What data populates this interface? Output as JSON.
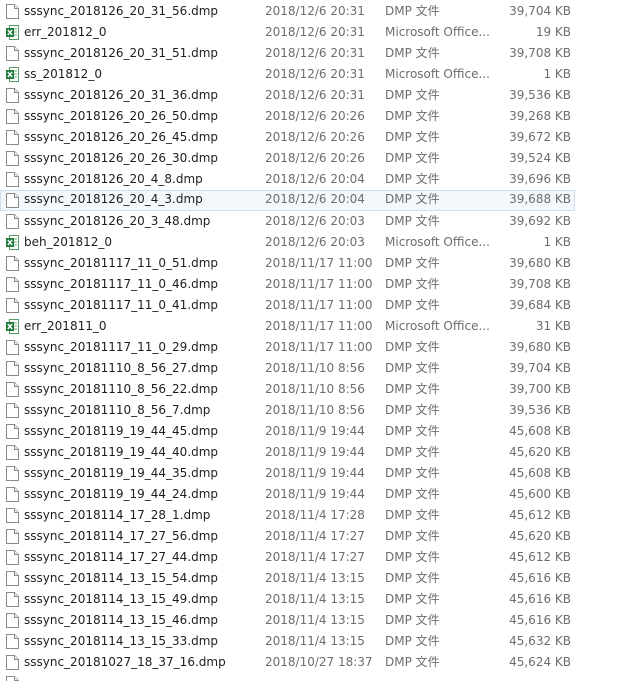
{
  "files": [
    {
      "name": "sssync_2018126_20_31_56.dmp",
      "date": "2018/12/6 20:31",
      "type": "DMP 文件",
      "size": "39,704 KB",
      "icon": "dmp-file-icon"
    },
    {
      "name": "err_201812_0",
      "date": "2018/12/6 20:31",
      "type": "Microsoft Office...",
      "size": "19 KB",
      "icon": "excel-file-icon"
    },
    {
      "name": "sssync_2018126_20_31_51.dmp",
      "date": "2018/12/6 20:31",
      "type": "DMP 文件",
      "size": "39,708 KB",
      "icon": "dmp-file-icon"
    },
    {
      "name": "ss_201812_0",
      "date": "2018/12/6 20:31",
      "type": "Microsoft Office...",
      "size": "1 KB",
      "icon": "excel-file-icon"
    },
    {
      "name": "sssync_2018126_20_31_36.dmp",
      "date": "2018/12/6 20:31",
      "type": "DMP 文件",
      "size": "39,536 KB",
      "icon": "dmp-file-icon"
    },
    {
      "name": "sssync_2018126_20_26_50.dmp",
      "date": "2018/12/6 20:26",
      "type": "DMP 文件",
      "size": "39,268 KB",
      "icon": "dmp-file-icon"
    },
    {
      "name": "sssync_2018126_20_26_45.dmp",
      "date": "2018/12/6 20:26",
      "type": "DMP 文件",
      "size": "39,672 KB",
      "icon": "dmp-file-icon"
    },
    {
      "name": "sssync_2018126_20_26_30.dmp",
      "date": "2018/12/6 20:26",
      "type": "DMP 文件",
      "size": "39,524 KB",
      "icon": "dmp-file-icon"
    },
    {
      "name": "sssync_2018126_20_4_8.dmp",
      "date": "2018/12/6 20:04",
      "type": "DMP 文件",
      "size": "39,696 KB",
      "icon": "dmp-file-icon"
    },
    {
      "name": "sssync_2018126_20_4_3.dmp",
      "date": "2018/12/6 20:04",
      "type": "DMP 文件",
      "size": "39,688 KB",
      "icon": "dmp-file-icon",
      "hovered": true
    },
    {
      "name": "sssync_2018126_20_3_48.dmp",
      "date": "2018/12/6 20:03",
      "type": "DMP 文件",
      "size": "39,692 KB",
      "icon": "dmp-file-icon"
    },
    {
      "name": "beh_201812_0",
      "date": "2018/12/6 20:03",
      "type": "Microsoft Office...",
      "size": "1 KB",
      "icon": "excel-file-icon"
    },
    {
      "name": "sssync_20181117_11_0_51.dmp",
      "date": "2018/11/17 11:00",
      "type": "DMP 文件",
      "size": "39,680 KB",
      "icon": "dmp-file-icon"
    },
    {
      "name": "sssync_20181117_11_0_46.dmp",
      "date": "2018/11/17 11:00",
      "type": "DMP 文件",
      "size": "39,708 KB",
      "icon": "dmp-file-icon"
    },
    {
      "name": "sssync_20181117_11_0_41.dmp",
      "date": "2018/11/17 11:00",
      "type": "DMP 文件",
      "size": "39,684 KB",
      "icon": "dmp-file-icon"
    },
    {
      "name": "err_201811_0",
      "date": "2018/11/17 11:00",
      "type": "Microsoft Office...",
      "size": "31 KB",
      "icon": "excel-file-icon"
    },
    {
      "name": "sssync_20181117_11_0_29.dmp",
      "date": "2018/11/17 11:00",
      "type": "DMP 文件",
      "size": "39,680 KB",
      "icon": "dmp-file-icon"
    },
    {
      "name": "sssync_20181110_8_56_27.dmp",
      "date": "2018/11/10 8:56",
      "type": "DMP 文件",
      "size": "39,704 KB",
      "icon": "dmp-file-icon"
    },
    {
      "name": "sssync_20181110_8_56_22.dmp",
      "date": "2018/11/10 8:56",
      "type": "DMP 文件",
      "size": "39,700 KB",
      "icon": "dmp-file-icon"
    },
    {
      "name": "sssync_20181110_8_56_7.dmp",
      "date": "2018/11/10 8:56",
      "type": "DMP 文件",
      "size": "39,536 KB",
      "icon": "dmp-file-icon"
    },
    {
      "name": "sssync_2018119_19_44_45.dmp",
      "date": "2018/11/9 19:44",
      "type": "DMP 文件",
      "size": "45,608 KB",
      "icon": "dmp-file-icon"
    },
    {
      "name": "sssync_2018119_19_44_40.dmp",
      "date": "2018/11/9 19:44",
      "type": "DMP 文件",
      "size": "45,620 KB",
      "icon": "dmp-file-icon"
    },
    {
      "name": "sssync_2018119_19_44_35.dmp",
      "date": "2018/11/9 19:44",
      "type": "DMP 文件",
      "size": "45,608 KB",
      "icon": "dmp-file-icon"
    },
    {
      "name": "sssync_2018119_19_44_24.dmp",
      "date": "2018/11/9 19:44",
      "type": "DMP 文件",
      "size": "45,600 KB",
      "icon": "dmp-file-icon"
    },
    {
      "name": "sssync_2018114_17_28_1.dmp",
      "date": "2018/11/4 17:28",
      "type": "DMP 文件",
      "size": "45,612 KB",
      "icon": "dmp-file-icon"
    },
    {
      "name": "sssync_2018114_17_27_56.dmp",
      "date": "2018/11/4 17:27",
      "type": "DMP 文件",
      "size": "45,620 KB",
      "icon": "dmp-file-icon"
    },
    {
      "name": "sssync_2018114_17_27_44.dmp",
      "date": "2018/11/4 17:27",
      "type": "DMP 文件",
      "size": "45,612 KB",
      "icon": "dmp-file-icon"
    },
    {
      "name": "sssync_2018114_13_15_54.dmp",
      "date": "2018/11/4 13:15",
      "type": "DMP 文件",
      "size": "45,616 KB",
      "icon": "dmp-file-icon"
    },
    {
      "name": "sssync_2018114_13_15_49.dmp",
      "date": "2018/11/4 13:15",
      "type": "DMP 文件",
      "size": "45,616 KB",
      "icon": "dmp-file-icon"
    },
    {
      "name": "sssync_2018114_13_15_46.dmp",
      "date": "2018/11/4 13:15",
      "type": "DMP 文件",
      "size": "45,616 KB",
      "icon": "dmp-file-icon"
    },
    {
      "name": "sssync_2018114_13_15_33.dmp",
      "date": "2018/11/4 13:15",
      "type": "DMP 文件",
      "size": "45,632 KB",
      "icon": "dmp-file-icon"
    },
    {
      "name": "sssync_20181027_18_37_16.dmp",
      "date": "2018/10/27 18:37",
      "type": "DMP 文件",
      "size": "45,624 KB",
      "icon": "dmp-file-icon"
    }
  ],
  "colors": {
    "name_text": "#1e1e1e",
    "detail_text": "#6d6d6d",
    "hover_background": "#f4f8fd",
    "hover_border": "#cfdff2",
    "excel_green": "#1f7a3a"
  }
}
